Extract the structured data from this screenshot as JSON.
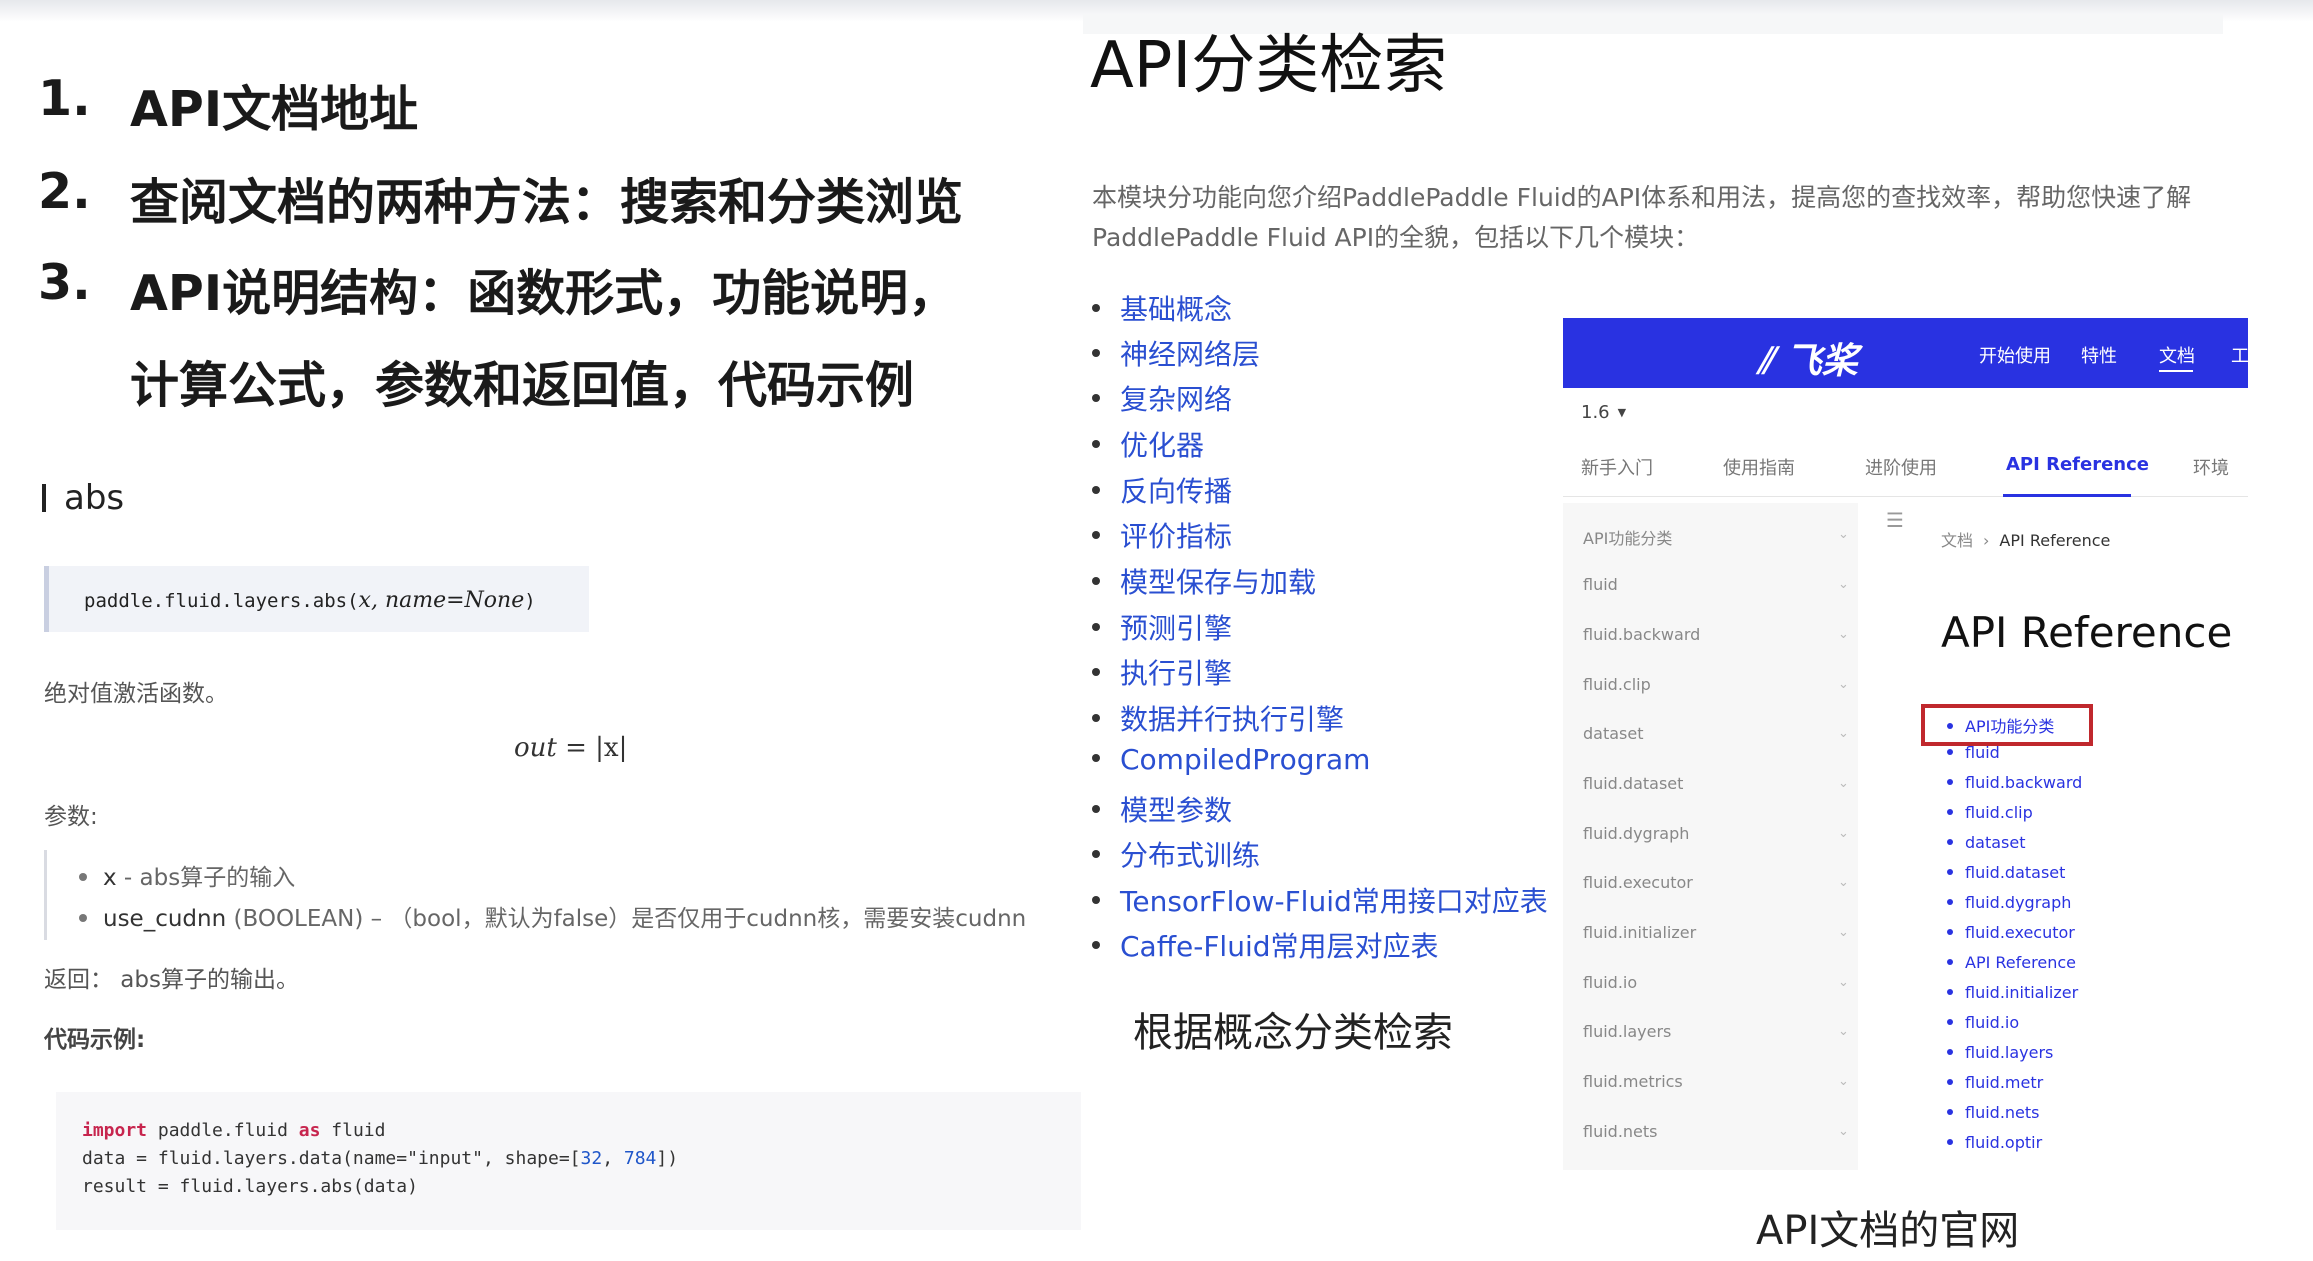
{
  "outline": [
    {
      "num": "1.",
      "text": "API文档地址"
    },
    {
      "num": "2.",
      "text": "查阅文档的两种方法：搜索和分类浏览"
    },
    {
      "num": "3.",
      "text": "API说明结构：函数形式，功能说明，"
    },
    {
      "num": "",
      "text": "计算公式，参数和返回值，代码示例"
    }
  ],
  "abs_doc": {
    "title": "abs",
    "signature": "paddle.fluid.layers.abs(",
    "signature_args": "x, name=None",
    "signature_end": ")",
    "description": "绝对值激活函数。",
    "formula_lhs": "out",
    "formula_rhs": " = |x|",
    "params_label": "参数:",
    "params": [
      {
        "name": "x",
        "desc": " - abs算子的输入"
      },
      {
        "name": "use_cudnn",
        "desc": " (BOOLEAN) – （bool，默认为false）是否仅用于cudnn核，需要安装cudnn"
      }
    ],
    "returns": "返回：  abs算子的输出。",
    "code_label": "代码示例:",
    "code": {
      "line1_kw1": "import",
      "line1_mid": " paddle.fluid ",
      "line1_kw2": "as",
      "line1_end": " fluid",
      "line2_a": "data = fluid.layers.data(name=\"input\", shape=[",
      "line2_n1": "32",
      "line2_b": ", ",
      "line2_n2": "784",
      "line2_c": "])",
      "line3": "result = fluid.layers.abs(data)"
    }
  },
  "category_page": {
    "title": "API分类检索",
    "intro": "本模块分功能向您介绍PaddlePaddle Fluid的API体系和用法，提高您的查找效率，帮助您快速了解PaddlePaddle Fluid API的全貌，包括以下几个模块：",
    "categories": [
      "基础概念",
      "神经网络层",
      "复杂网络",
      "优化器",
      "反向传播",
      "评价指标",
      "模型保存与加载",
      "预测引擎",
      "执行引擎",
      "数据并行执行引擎",
      "CompiledProgram",
      "模型参数",
      "分布式训练",
      "TensorFlow-Fluid常用接口对应表",
      "Caffe-Fluid常用层对应表"
    ],
    "caption": "根据概念分类检索"
  },
  "site": {
    "logo": "飞桨",
    "nav": [
      "开始使用",
      "特性",
      "文档",
      "工"
    ],
    "version": "1.6",
    "tabs": [
      "新手入门",
      "使用指南",
      "进阶使用",
      "API Reference",
      "环境"
    ],
    "sidebar": [
      "API功能分类",
      "fluid",
      "fluid.backward",
      "fluid.clip",
      "dataset",
      "fluid.dataset",
      "fluid.dygraph",
      "fluid.executor",
      "fluid.initializer",
      "fluid.io",
      "fluid.layers",
      "fluid.metrics",
      "fluid.nets"
    ],
    "breadcrumb": {
      "root": "文档",
      "sep": "›",
      "current": "API Reference"
    },
    "heading": "API Reference",
    "toc": [
      "API功能分类",
      "fluid",
      "fluid.backward",
      "fluid.clip",
      "dataset",
      "fluid.dataset",
      "fluid.dygraph",
      "fluid.executor",
      "API Reference",
      "fluid.initializer",
      "fluid.io",
      "fluid.layers",
      "fluid.metr",
      "fluid.nets",
      "fluid.optir"
    ],
    "caption": "API文档的官网"
  },
  "colors": {
    "brand_blue": "#2932e1",
    "link_blue": "#2a4fd1",
    "highlight_red": "#c0282d"
  }
}
